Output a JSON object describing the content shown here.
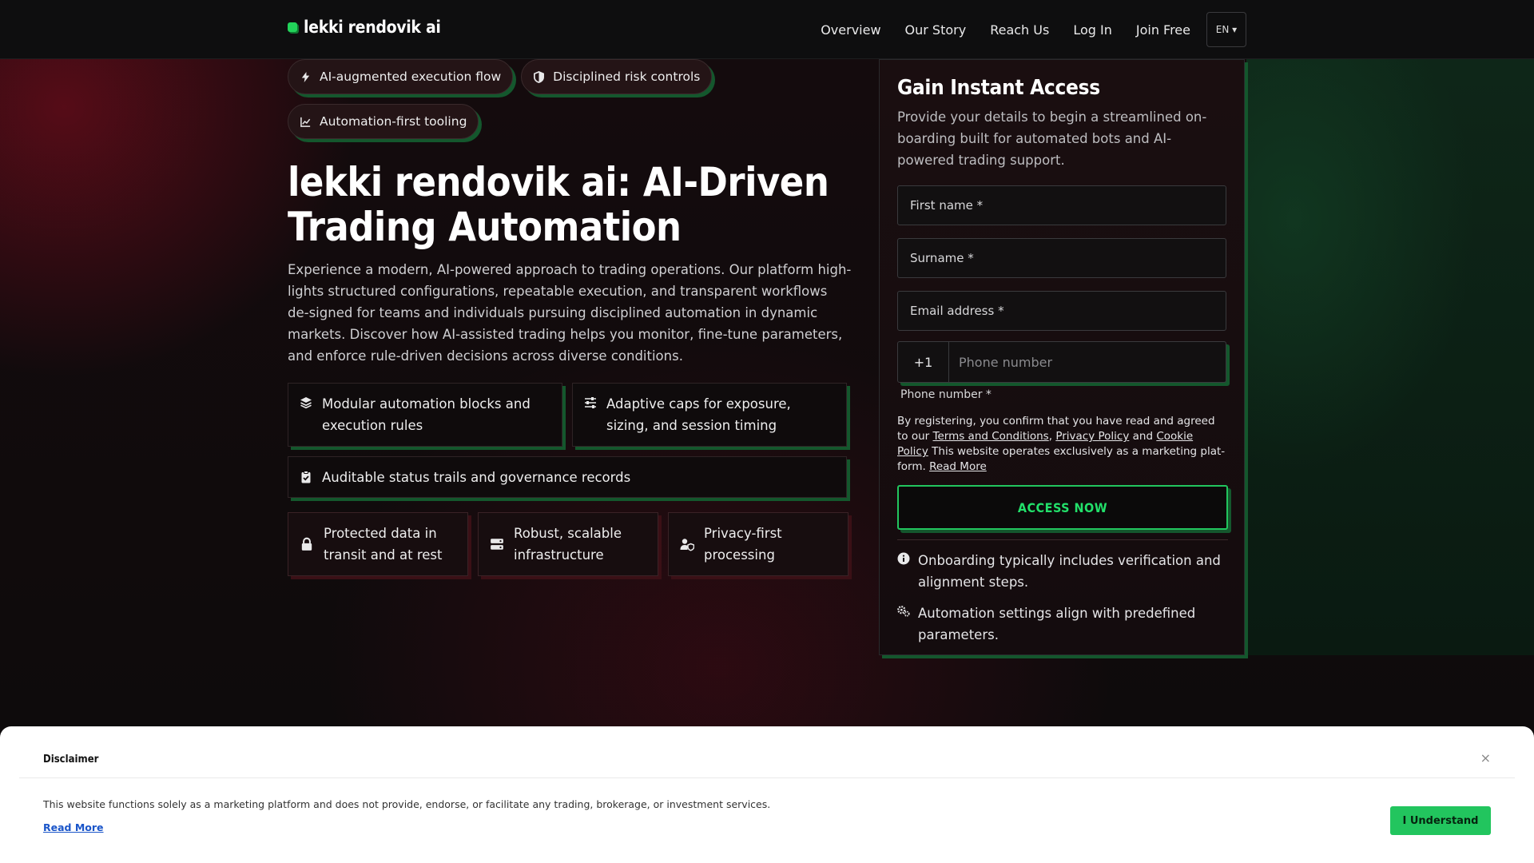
{
  "brand": {
    "name": "lekki rendovik ai",
    "accent": "#22c55e"
  },
  "nav": {
    "items": [
      "Overview",
      "Our Story",
      "Reach Us",
      "Log In",
      "Join Free"
    ],
    "language": "EN ▾"
  },
  "hero": {
    "pills": [
      {
        "label": "AI-augmented execution flow",
        "icon": "bolt-icon"
      },
      {
        "label": "Disciplined risk controls",
        "icon": "shield-icon"
      },
      {
        "label": "Automation-first tooling",
        "icon": "chart-line-icon"
      }
    ],
    "title": "lekki rendovik ai: AI-Driven Trading Automation",
    "lead": "Experience a modern, AI-powered approach to trading operations. Our platform high-lights structured configurations, repeatable execution, and transparent workflows de-signed for teams and individuals pursuing disciplined automation in dynamic markets. Discover how AI-assisted trading helps you monitor, fine-tune parameters, and enforce rule-driven decisions across diverse conditions.",
    "features": [
      {
        "label": "Modular automation blocks and execution rules",
        "icon": "layers-icon"
      },
      {
        "label": "Adaptive caps for exposure, sizing, and session timing",
        "icon": "sliders-icon"
      },
      {
        "label": "Auditable status trails and governance records",
        "icon": "clipboard-check-icon"
      }
    ],
    "trust": [
      {
        "label": "Protected data in transit and at rest",
        "icon": "lock-icon"
      },
      {
        "label": "Robust, scalable infrastructure",
        "icon": "server-icon"
      },
      {
        "label": "Privacy-first processing",
        "icon": "user-shield-icon"
      }
    ]
  },
  "form": {
    "title": "Gain Instant Access",
    "subtitle": "Provide your details to begin a streamlined on-boarding built for automated bots and AI-powered trading support.",
    "first_name": "First name *",
    "surname": "Surname *",
    "email": "Email address *",
    "phone_code": "+1",
    "phone_placeholder": "Phone number",
    "phone_label": "Phone number *",
    "legal_prefix": "By registering, you confirm that you have read and agreed to our",
    "terms": "Terms and Conditions",
    "privacy": "Privacy Policy",
    "and": "and",
    "cookie": "Cookie Policy",
    "legal_suffix": "This website operates exclusively as a marketing plat-form.",
    "read_more": "Read More",
    "submit": "ACCESS NOW",
    "notes": [
      {
        "label": "Onboarding typically includes verification and alignment steps.",
        "icon": "info-icon"
      },
      {
        "label": "Automation settings align with predefined parameters.",
        "icon": "gears-icon"
      }
    ]
  },
  "disclaimer": {
    "title": "Disclaimer",
    "close": "×",
    "text": "This website functions solely as a marketing platform and does not provide, endorse, or facilitate any trading, brokerage, or investment services.",
    "read_more": "Read More",
    "accept": "I Understand"
  }
}
